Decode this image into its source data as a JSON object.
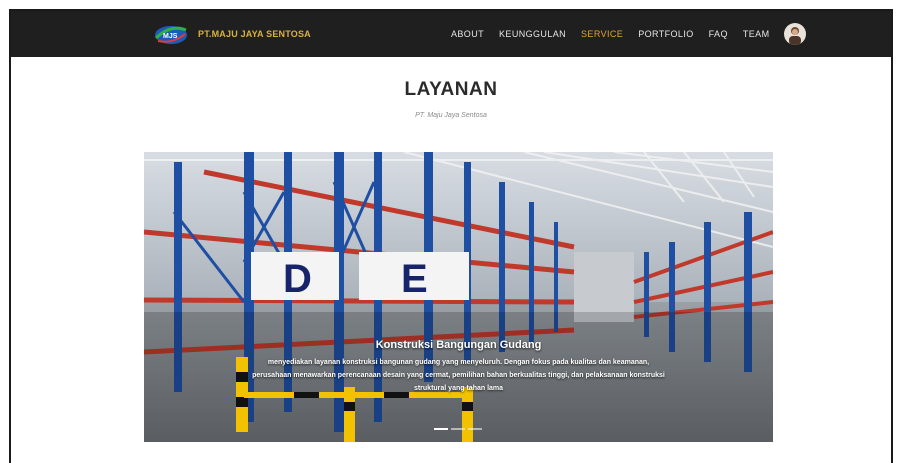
{
  "brand": {
    "name": "PT.MAJU JAYA SENTOSA",
    "logo_text": "MJS"
  },
  "nav": {
    "items": [
      "ABOUT",
      "KEUNGGULAN",
      "SERVICE",
      "PORTFOLIO",
      "FAQ",
      "TEAM"
    ],
    "active": "SERVICE"
  },
  "section": {
    "title": "LAYANAN",
    "subtitle": "PT. Maju Jaya Sentosa"
  },
  "carousel": {
    "sign_letters": [
      "D",
      "E"
    ],
    "slide_title": "Konstruksi Bangungan Gudang",
    "slide_text": "menyediakan layanan konstruksi bangunan gudang yang menyeluruh. Dengan fokus pada kualitas dan keamanan, perusahaan menawarkan perencanaan desain yang cermat, pemilihan bahan berkualitas tinggi, dan pelaksanaan konstruksi struktural yang tahan lama",
    "slide_count": 3,
    "active_slide": 1
  },
  "colors": {
    "navbar_bg": "#1f1f1f",
    "accent": "#e3a623",
    "rack_blue": "#1f4fa3",
    "rack_red": "#c0392b",
    "bollard_yellow": "#f2c200"
  }
}
